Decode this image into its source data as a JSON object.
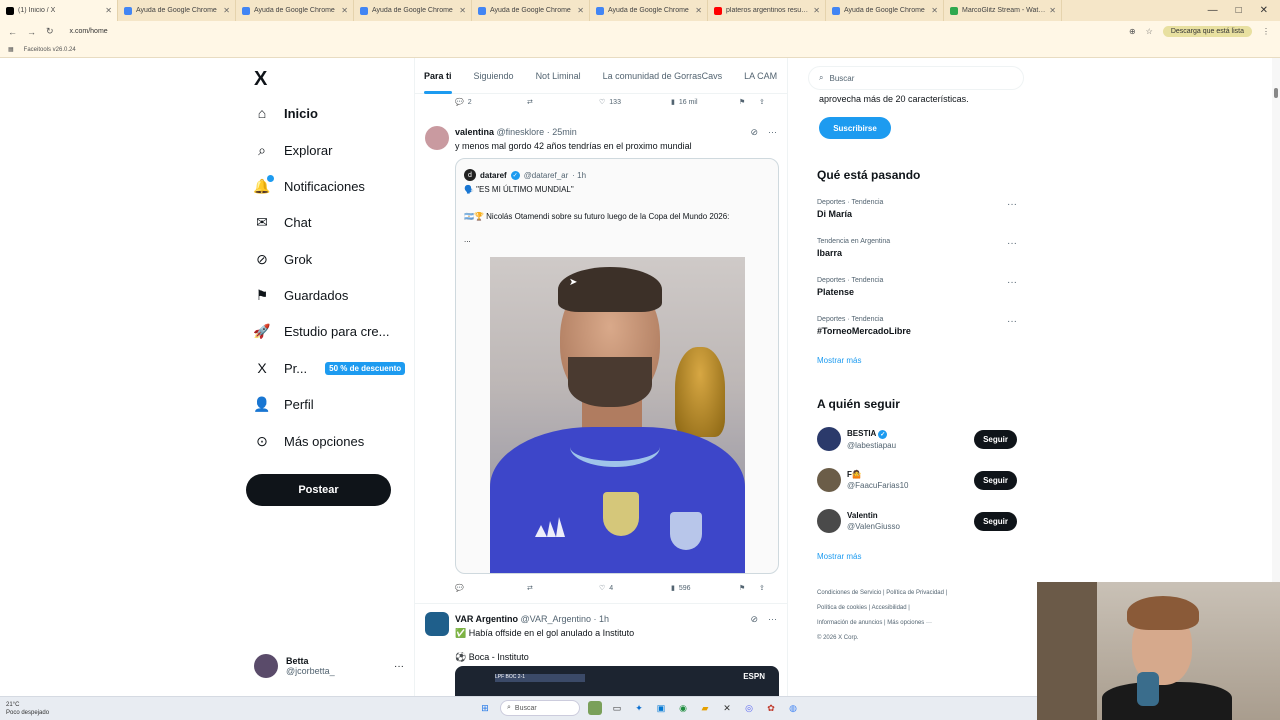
{
  "browser": {
    "tabs": [
      {
        "title": "(1) Inicio / X",
        "color": "#000000",
        "active": true
      },
      {
        "title": "Ayuda de Google Chrome",
        "color": "#4285f4"
      },
      {
        "title": "Ayuda de Google Chrome",
        "color": "#4285f4"
      },
      {
        "title": "Ayuda de Google Chrome",
        "color": "#4285f4"
      },
      {
        "title": "Ayuda de Google Chrome",
        "color": "#4285f4"
      },
      {
        "title": "Ayuda de Google Chrome",
        "color": "#4285f4"
      },
      {
        "title": "plateros argentinos resumen...",
        "color": "#ff0000"
      },
      {
        "title": "Ayuda de Google Chrome",
        "color": "#4285f4"
      },
      {
        "title": "MarcoGlitz Stream - Watch Li...",
        "color": "#2fa84f"
      }
    ],
    "url": "x.com/home",
    "update_label": "Descarga que está lista",
    "bookmark": "Faceitools v26.0.24",
    "window_controls": [
      "—",
      "□",
      "✕"
    ]
  },
  "nav": {
    "logo": "X",
    "items": [
      {
        "label": "Inicio",
        "icon": "home-icon",
        "glyph": "⌂"
      },
      {
        "label": "Explorar",
        "icon": "search-icon",
        "glyph": "⌕"
      },
      {
        "label": "Notificaciones",
        "icon": "bell-icon",
        "glyph": "🔔"
      },
      {
        "label": "Chat",
        "icon": "mail-icon",
        "glyph": "✉"
      },
      {
        "label": "Grok",
        "icon": "grok-icon",
        "glyph": "⊘"
      },
      {
        "label": "Guardados",
        "icon": "bookmark-icon",
        "glyph": "⚑"
      },
      {
        "label": "Estudio para cre...",
        "icon": "rocket-icon",
        "glyph": "🚀"
      },
      {
        "label": "Pr...",
        "icon": "x-premium-icon",
        "glyph": "X"
      },
      {
        "label": "Perfil",
        "icon": "person-icon",
        "glyph": "👤"
      },
      {
        "label": "Más opciones",
        "icon": "more-circle-icon",
        "glyph": "⊙"
      }
    ],
    "premium_discount": "50 % de descuento",
    "post_button": "Postear",
    "account": {
      "name": "Betta",
      "handle": "@jcorbetta_",
      "more": "···"
    }
  },
  "feed": {
    "tabs": [
      "Para ti",
      "Siguiendo",
      "Not Liminal",
      "La comunidad de GorrasCavs",
      "LA CAM"
    ],
    "prev_actions": {
      "replies": "2",
      "likes": "133",
      "views": "16 mil"
    },
    "tweet1": {
      "name": "valentina",
      "handle": "@finesklore",
      "time": "· 25min",
      "text": "y menos mal gordo 42 años tendrías en el proximo mundial",
      "quote": {
        "name": "dataref",
        "handle": "@dataref_ar",
        "time": "· 1h",
        "line1": "🗣️ \"ES MI ÚLTIMO MUNDIAL\"",
        "line2": "🇦🇷🏆 Nicolás Otamendi sobre su futuro luego de la Copa del Mundo 2026:",
        "line3": "..."
      },
      "actions": {
        "replies": "",
        "likes": "4",
        "views": "596"
      }
    },
    "tweet2": {
      "name": "VAR Argentino",
      "handle": "@VAR_Argentino",
      "time": "· 1h",
      "line1": "✅ Había offside en el gol anulado a Instituto",
      "line2": "⚽ Boca - Instituto",
      "scoreboard": "LPF  BOC 2-1",
      "network": "ESPN"
    }
  },
  "right": {
    "search_placeholder": "Buscar",
    "premium_tail": "aprovecha más de 20 características.",
    "subscribe": "Suscribirse",
    "trending_title": "Qué está pasando",
    "trends": [
      {
        "category": "Deportes · Tendencia",
        "name": "Di María"
      },
      {
        "category": "Tendencia en Argentina",
        "name": "Ibarra"
      },
      {
        "category": "Deportes · Tendencia",
        "name": "Platense"
      },
      {
        "category": "Deportes · Tendencia",
        "name": "#TorneoMercadoLibre"
      }
    ],
    "show_more": "Mostrar más",
    "who_title": "A quién seguir",
    "who": [
      {
        "name": "BESTIA",
        "handle": "@labestiapau",
        "verified": true,
        "color": "#2b3a6b"
      },
      {
        "name": "F🤷",
        "handle": "@FaacuFarias10",
        "verified": false,
        "color": "#6b5d48"
      },
      {
        "name": "Valentin",
        "handle": "@ValenGiusso",
        "verified": false,
        "color": "#4a4a4a"
      }
    ],
    "follow_label": "Seguir",
    "footer": [
      "Condiciones de Servicio  |  Política de Privacidad  |",
      "Política de cookies  |  Accesibilidad  |",
      "Información de anuncios  |  Más opciones ···",
      "© 2026 X Corp."
    ]
  },
  "taskbar": {
    "weather_temp": "21°C",
    "weather_desc": "Poco despejado",
    "search": "Buscar"
  }
}
